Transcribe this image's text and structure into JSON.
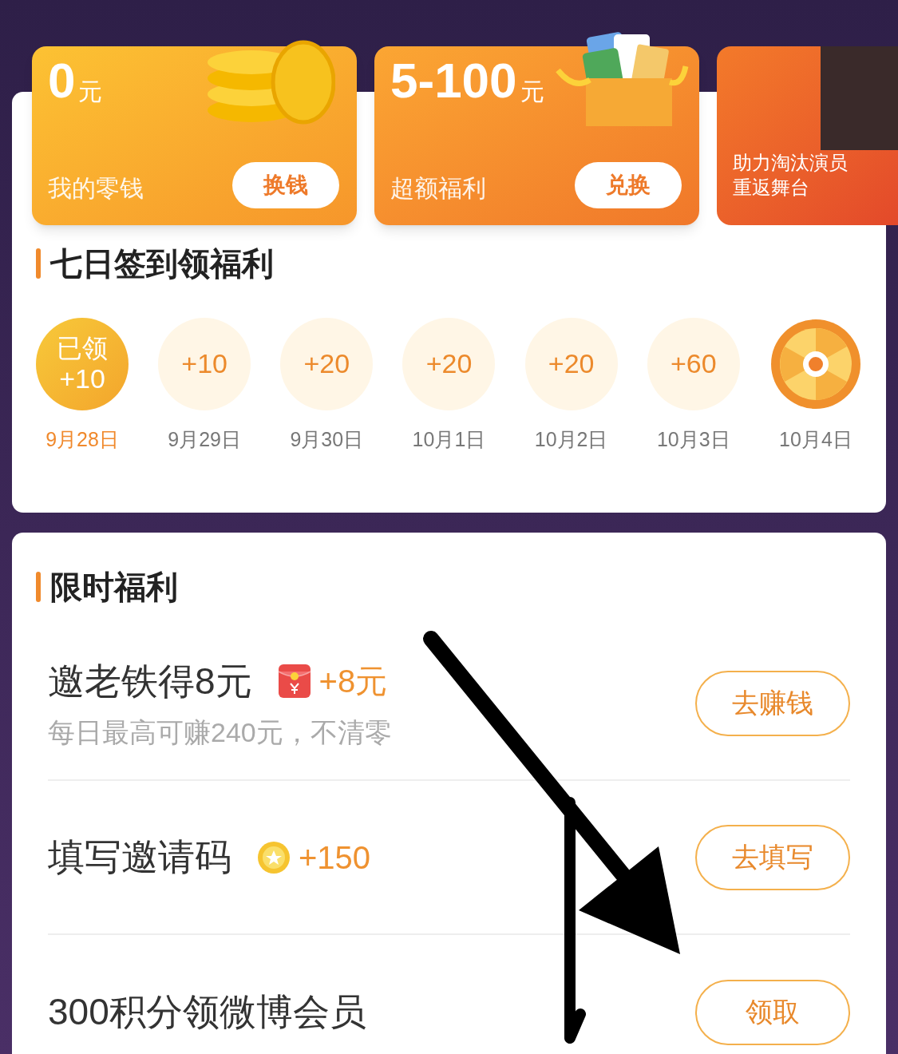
{
  "wallet_cards": [
    {
      "kind": "coins",
      "amount": "0",
      "unit": "元",
      "label": "我的零钱",
      "button": "换钱"
    },
    {
      "kind": "giftbox",
      "amount": "5-100",
      "unit": "元",
      "label": "超额福利",
      "button": "兑换"
    },
    {
      "kind": "promo",
      "lines": [
        "助力淘汰演员",
        "重返舞台"
      ]
    }
  ],
  "checkin": {
    "title": "七日签到领福利",
    "days": [
      {
        "kind": "points",
        "claimed": true,
        "status": "已领",
        "reward": "+10",
        "date": "9月28日"
      },
      {
        "kind": "points",
        "claimed": false,
        "reward": "+10",
        "date": "9月29日"
      },
      {
        "kind": "points",
        "claimed": false,
        "reward": "+20",
        "date": "9月30日"
      },
      {
        "kind": "points",
        "claimed": false,
        "reward": "+20",
        "date": "10月1日"
      },
      {
        "kind": "points",
        "claimed": false,
        "reward": "+20",
        "date": "10月2日"
      },
      {
        "kind": "points",
        "claimed": false,
        "reward": "+60",
        "date": "10月3日"
      },
      {
        "kind": "wheel",
        "claimed": false,
        "date": "10月4日"
      }
    ]
  },
  "limited": {
    "title": "限时福利",
    "tasks": [
      {
        "title": "邀老铁得8元",
        "kind": "red_packet",
        "reward": "+8元",
        "subtitle": "每日最高可赚240元，不清零",
        "button": "去赚钱"
      },
      {
        "title": "填写邀请码",
        "kind": "coin",
        "reward": "+150",
        "button": "去填写"
      },
      {
        "title": "300积分领微博会员",
        "button": "领取"
      }
    ]
  }
}
